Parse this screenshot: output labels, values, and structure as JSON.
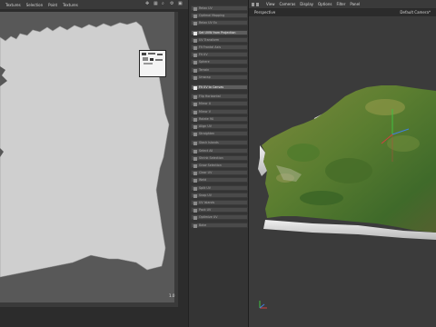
{
  "uv_editor": {
    "menu": [
      "Textures",
      "Selection",
      "Point",
      "Textures"
    ],
    "tool_icons": [
      "move-icon",
      "grid-icon",
      "zoom-icon",
      "gear-icon",
      "layout-icon"
    ],
    "axis_label_right": "1.0"
  },
  "command_panel": {
    "items": [
      {
        "label": "Relax UV",
        "active": false
      },
      {
        "label": "Optimal Mapping",
        "active": false
      },
      {
        "label": "Relax UV Ex",
        "active": false
      },
      {
        "label": "Set UVW from Projection",
        "active": true
      },
      {
        "label": "UV Transform",
        "active": false
      },
      {
        "label": "Fit Frontal Axis",
        "active": false
      },
      {
        "label": "Fit UV",
        "active": false
      },
      {
        "label": "Sphere",
        "active": false
      },
      {
        "label": "Terrain",
        "active": false
      },
      {
        "label": "Unwrap",
        "active": false
      },
      {
        "label": "Fit UV to Canvas",
        "active": true
      },
      {
        "label": "Flip Horizontal",
        "active": false
      },
      {
        "label": "Mirror U",
        "active": false
      },
      {
        "label": "Mirror V",
        "active": false
      },
      {
        "label": "Rotate 90",
        "active": false
      },
      {
        "label": "Align UV",
        "active": false
      },
      {
        "label": "Straighten",
        "active": false
      },
      {
        "label": "Stack Islands",
        "active": false
      },
      {
        "label": "Select All",
        "active": false
      },
      {
        "label": "Shrink Selection",
        "active": false
      },
      {
        "label": "Grow Selection",
        "active": false
      },
      {
        "label": "Clear UV",
        "active": false
      },
      {
        "label": "Weld",
        "active": false
      },
      {
        "label": "Split UV",
        "active": false
      },
      {
        "label": "Snap UV",
        "active": false
      },
      {
        "label": "UV Islands",
        "active": false
      },
      {
        "label": "Pack UV",
        "active": false
      },
      {
        "label": "Optimize UV",
        "active": false
      },
      {
        "label": "Bake",
        "active": false
      }
    ]
  },
  "viewport": {
    "menu": [
      "View",
      "Cameras",
      "Display",
      "Options",
      "Filter",
      "Panel"
    ],
    "view_name": "Perspective",
    "camera_name": "Default Camera*"
  },
  "colors": {
    "uv_bg": "#585858",
    "uv_shape": "#cfcfcf",
    "viewport_bg": "#3b3b3b",
    "terrain_green": "#5c7f32",
    "terrain_side": "#d8d8d8",
    "axis_x": "#d04040",
    "axis_y": "#40c040",
    "axis_z": "#4080e0"
  }
}
